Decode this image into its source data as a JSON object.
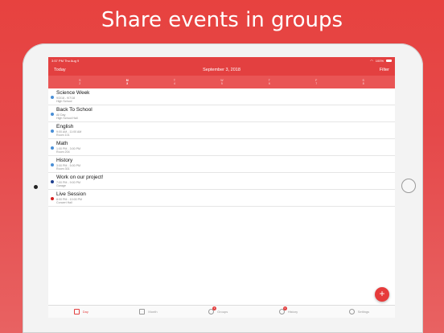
{
  "headline": "Share events in groups",
  "status_bar": {
    "time": "3:57 PM",
    "date": "Thu Aug 9",
    "battery": "100%"
  },
  "navbar": {
    "today": "Today",
    "title": "September 3, 2018",
    "filter": "Filter"
  },
  "week_days": [
    {
      "letter": "S",
      "num": "2"
    },
    {
      "letter": "M",
      "num": "3"
    },
    {
      "letter": "T",
      "num": "4"
    },
    {
      "letter": "W",
      "num": "5"
    },
    {
      "letter": "T",
      "num": "6"
    },
    {
      "letter": "F",
      "num": "7"
    },
    {
      "letter": "S",
      "num": "8"
    }
  ],
  "events": [
    {
      "title": "Science Week",
      "time": "9/3/18 - 9/7/18",
      "location": "High School",
      "color": "#4a8fd6"
    },
    {
      "title": "Back To School",
      "time": "All Day",
      "location": "High School Hall",
      "color": "#4a8fd6"
    },
    {
      "title": "English",
      "time": "9:00 AM - 11:00 AM",
      "location": "Room 101",
      "color": "#4a8fd6"
    },
    {
      "title": "Math",
      "time": "1:00 PM - 3:00 PM",
      "location": "Room 204",
      "color": "#4a8fd6"
    },
    {
      "title": "History",
      "time": "3:00 PM - 5:00 PM",
      "location": "Room 301",
      "color": "#4a8fd6"
    },
    {
      "title": "Work on our project!",
      "time": "7:00 PM - 9:00 PM",
      "location": "Garage",
      "color": "#1f3f8f"
    },
    {
      "title": "Live Session",
      "time": "8:00 PM - 10:00 PM",
      "location": "Concert Hall",
      "color": "#d61f1f"
    }
  ],
  "fab_label": "+",
  "tabs": [
    {
      "label": "Day",
      "badge": ""
    },
    {
      "label": "Month",
      "badge": ""
    },
    {
      "label": "Groups",
      "badge": "1"
    },
    {
      "label": "History",
      "badge": "1"
    },
    {
      "label": "Settings",
      "badge": ""
    }
  ],
  "colors": {
    "accent": "#e34040",
    "background": "#e5494a"
  }
}
